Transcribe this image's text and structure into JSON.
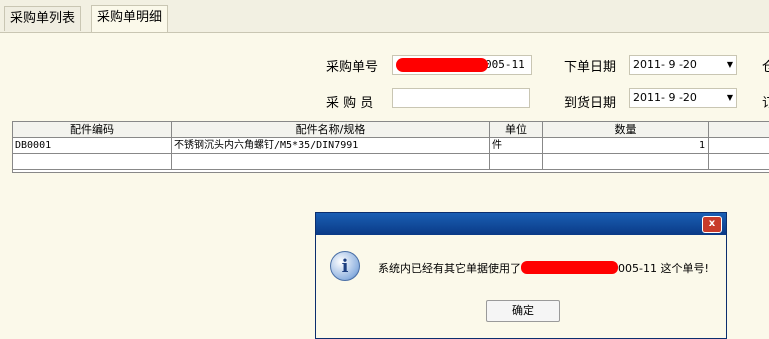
{
  "tabs": [
    {
      "label": "采购单列表"
    },
    {
      "label": "采购单明细"
    }
  ],
  "form": {
    "order_no_label": "采购单号",
    "order_no_suffix": "005-11",
    "buyer_label": "采 购 员",
    "buyer_value": "",
    "order_date_label": "下单日期",
    "order_date_value": "2011- 9 -20",
    "arrival_date_label": "到货日期",
    "arrival_date_value": "2011- 9 -20",
    "right_cut_1": "仓",
    "right_cut_2": "订"
  },
  "table": {
    "headers": [
      "配件编码",
      "配件名称/规格",
      "单位",
      "数量",
      ""
    ],
    "rows": [
      [
        "DB0001",
        "不锈钢沉头内六角螺钉/M5*35/DIN7991",
        "件",
        "1",
        ""
      ],
      [
        "",
        "",
        "",
        "",
        ""
      ]
    ]
  },
  "dialog": {
    "message_prefix": "系统内已经有其它单据使用了",
    "message_suffix": "005-11 这个单号!",
    "ok_label": "确定",
    "close_glyph": "x",
    "icon": "info-icon",
    "icon_glyph": "i",
    "redaction_color": "#ff0000"
  }
}
